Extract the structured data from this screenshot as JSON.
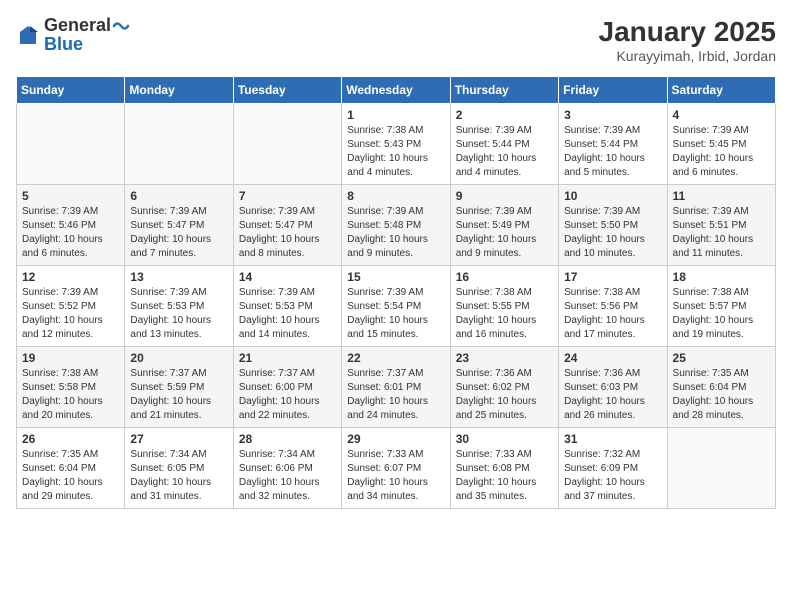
{
  "logo": {
    "general": "General",
    "blue": "Blue"
  },
  "title": "January 2025",
  "subtitle": "Kurayyimah, Irbid, Jordan",
  "days_of_week": [
    "Sunday",
    "Monday",
    "Tuesday",
    "Wednesday",
    "Thursday",
    "Friday",
    "Saturday"
  ],
  "weeks": [
    [
      {
        "day": "",
        "sunrise": "",
        "sunset": "",
        "daylight": "",
        "empty": true
      },
      {
        "day": "",
        "sunrise": "",
        "sunset": "",
        "daylight": "",
        "empty": true
      },
      {
        "day": "",
        "sunrise": "",
        "sunset": "",
        "daylight": "",
        "empty": true
      },
      {
        "day": "1",
        "sunrise": "Sunrise: 7:38 AM",
        "sunset": "Sunset: 5:43 PM",
        "daylight": "Daylight: 10 hours and 4 minutes.",
        "empty": false
      },
      {
        "day": "2",
        "sunrise": "Sunrise: 7:39 AM",
        "sunset": "Sunset: 5:44 PM",
        "daylight": "Daylight: 10 hours and 4 minutes.",
        "empty": false
      },
      {
        "day": "3",
        "sunrise": "Sunrise: 7:39 AM",
        "sunset": "Sunset: 5:44 PM",
        "daylight": "Daylight: 10 hours and 5 minutes.",
        "empty": false
      },
      {
        "day": "4",
        "sunrise": "Sunrise: 7:39 AM",
        "sunset": "Sunset: 5:45 PM",
        "daylight": "Daylight: 10 hours and 6 minutes.",
        "empty": false
      }
    ],
    [
      {
        "day": "5",
        "sunrise": "Sunrise: 7:39 AM",
        "sunset": "Sunset: 5:46 PM",
        "daylight": "Daylight: 10 hours and 6 minutes.",
        "empty": false
      },
      {
        "day": "6",
        "sunrise": "Sunrise: 7:39 AM",
        "sunset": "Sunset: 5:47 PM",
        "daylight": "Daylight: 10 hours and 7 minutes.",
        "empty": false
      },
      {
        "day": "7",
        "sunrise": "Sunrise: 7:39 AM",
        "sunset": "Sunset: 5:47 PM",
        "daylight": "Daylight: 10 hours and 8 minutes.",
        "empty": false
      },
      {
        "day": "8",
        "sunrise": "Sunrise: 7:39 AM",
        "sunset": "Sunset: 5:48 PM",
        "daylight": "Daylight: 10 hours and 9 minutes.",
        "empty": false
      },
      {
        "day": "9",
        "sunrise": "Sunrise: 7:39 AM",
        "sunset": "Sunset: 5:49 PM",
        "daylight": "Daylight: 10 hours and 9 minutes.",
        "empty": false
      },
      {
        "day": "10",
        "sunrise": "Sunrise: 7:39 AM",
        "sunset": "Sunset: 5:50 PM",
        "daylight": "Daylight: 10 hours and 10 minutes.",
        "empty": false
      },
      {
        "day": "11",
        "sunrise": "Sunrise: 7:39 AM",
        "sunset": "Sunset: 5:51 PM",
        "daylight": "Daylight: 10 hours and 11 minutes.",
        "empty": false
      }
    ],
    [
      {
        "day": "12",
        "sunrise": "Sunrise: 7:39 AM",
        "sunset": "Sunset: 5:52 PM",
        "daylight": "Daylight: 10 hours and 12 minutes.",
        "empty": false
      },
      {
        "day": "13",
        "sunrise": "Sunrise: 7:39 AM",
        "sunset": "Sunset: 5:53 PM",
        "daylight": "Daylight: 10 hours and 13 minutes.",
        "empty": false
      },
      {
        "day": "14",
        "sunrise": "Sunrise: 7:39 AM",
        "sunset": "Sunset: 5:53 PM",
        "daylight": "Daylight: 10 hours and 14 minutes.",
        "empty": false
      },
      {
        "day": "15",
        "sunrise": "Sunrise: 7:39 AM",
        "sunset": "Sunset: 5:54 PM",
        "daylight": "Daylight: 10 hours and 15 minutes.",
        "empty": false
      },
      {
        "day": "16",
        "sunrise": "Sunrise: 7:38 AM",
        "sunset": "Sunset: 5:55 PM",
        "daylight": "Daylight: 10 hours and 16 minutes.",
        "empty": false
      },
      {
        "day": "17",
        "sunrise": "Sunrise: 7:38 AM",
        "sunset": "Sunset: 5:56 PM",
        "daylight": "Daylight: 10 hours and 17 minutes.",
        "empty": false
      },
      {
        "day": "18",
        "sunrise": "Sunrise: 7:38 AM",
        "sunset": "Sunset: 5:57 PM",
        "daylight": "Daylight: 10 hours and 19 minutes.",
        "empty": false
      }
    ],
    [
      {
        "day": "19",
        "sunrise": "Sunrise: 7:38 AM",
        "sunset": "Sunset: 5:58 PM",
        "daylight": "Daylight: 10 hours and 20 minutes.",
        "empty": false
      },
      {
        "day": "20",
        "sunrise": "Sunrise: 7:37 AM",
        "sunset": "Sunset: 5:59 PM",
        "daylight": "Daylight: 10 hours and 21 minutes.",
        "empty": false
      },
      {
        "day": "21",
        "sunrise": "Sunrise: 7:37 AM",
        "sunset": "Sunset: 6:00 PM",
        "daylight": "Daylight: 10 hours and 22 minutes.",
        "empty": false
      },
      {
        "day": "22",
        "sunrise": "Sunrise: 7:37 AM",
        "sunset": "Sunset: 6:01 PM",
        "daylight": "Daylight: 10 hours and 24 minutes.",
        "empty": false
      },
      {
        "day": "23",
        "sunrise": "Sunrise: 7:36 AM",
        "sunset": "Sunset: 6:02 PM",
        "daylight": "Daylight: 10 hours and 25 minutes.",
        "empty": false
      },
      {
        "day": "24",
        "sunrise": "Sunrise: 7:36 AM",
        "sunset": "Sunset: 6:03 PM",
        "daylight": "Daylight: 10 hours and 26 minutes.",
        "empty": false
      },
      {
        "day": "25",
        "sunrise": "Sunrise: 7:35 AM",
        "sunset": "Sunset: 6:04 PM",
        "daylight": "Daylight: 10 hours and 28 minutes.",
        "empty": false
      }
    ],
    [
      {
        "day": "26",
        "sunrise": "Sunrise: 7:35 AM",
        "sunset": "Sunset: 6:04 PM",
        "daylight": "Daylight: 10 hours and 29 minutes.",
        "empty": false
      },
      {
        "day": "27",
        "sunrise": "Sunrise: 7:34 AM",
        "sunset": "Sunset: 6:05 PM",
        "daylight": "Daylight: 10 hours and 31 minutes.",
        "empty": false
      },
      {
        "day": "28",
        "sunrise": "Sunrise: 7:34 AM",
        "sunset": "Sunset: 6:06 PM",
        "daylight": "Daylight: 10 hours and 32 minutes.",
        "empty": false
      },
      {
        "day": "29",
        "sunrise": "Sunrise: 7:33 AM",
        "sunset": "Sunset: 6:07 PM",
        "daylight": "Daylight: 10 hours and 34 minutes.",
        "empty": false
      },
      {
        "day": "30",
        "sunrise": "Sunrise: 7:33 AM",
        "sunset": "Sunset: 6:08 PM",
        "daylight": "Daylight: 10 hours and 35 minutes.",
        "empty": false
      },
      {
        "day": "31",
        "sunrise": "Sunrise: 7:32 AM",
        "sunset": "Sunset: 6:09 PM",
        "daylight": "Daylight: 10 hours and 37 minutes.",
        "empty": false
      },
      {
        "day": "",
        "sunrise": "",
        "sunset": "",
        "daylight": "",
        "empty": true
      }
    ]
  ]
}
